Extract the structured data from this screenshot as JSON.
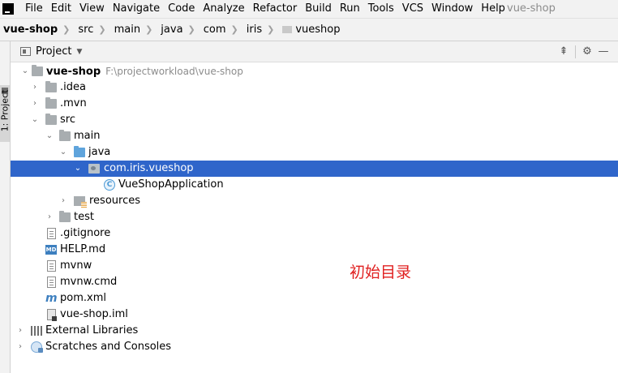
{
  "menu": {
    "items": [
      "File",
      "Edit",
      "View",
      "Navigate",
      "Code",
      "Analyze",
      "Refactor",
      "Build",
      "Run",
      "Tools",
      "VCS",
      "Window",
      "Help"
    ],
    "project_title": "vue-shop"
  },
  "breadcrumb": [
    "vue-shop",
    "src",
    "main",
    "java",
    "com",
    "iris",
    "vueshop"
  ],
  "left_strip": {
    "tab_label": "1: Project"
  },
  "tool_window": {
    "title": "Project"
  },
  "tree": {
    "root": {
      "name": "vue-shop",
      "path": "F:\\projectworkload\\vue-shop"
    },
    "idea": ".idea",
    "mvn": ".mvn",
    "src": "src",
    "main": "main",
    "java": "java",
    "package": "com.iris.vueshop",
    "app_class": "VueShopApplication",
    "resources": "resources",
    "test": "test",
    "gitignore": ".gitignore",
    "help_md": "HELP.md",
    "mvnw": "mvnw",
    "mvnw_cmd": "mvnw.cmd",
    "pom": "pom.xml",
    "iml": "vue-shop.iml",
    "external_libraries": "External Libraries",
    "scratches": "Scratches and Consoles"
  },
  "annotation": "初始目录",
  "colors": {
    "selection": "#2f65ca",
    "annotation": "#e02020"
  }
}
